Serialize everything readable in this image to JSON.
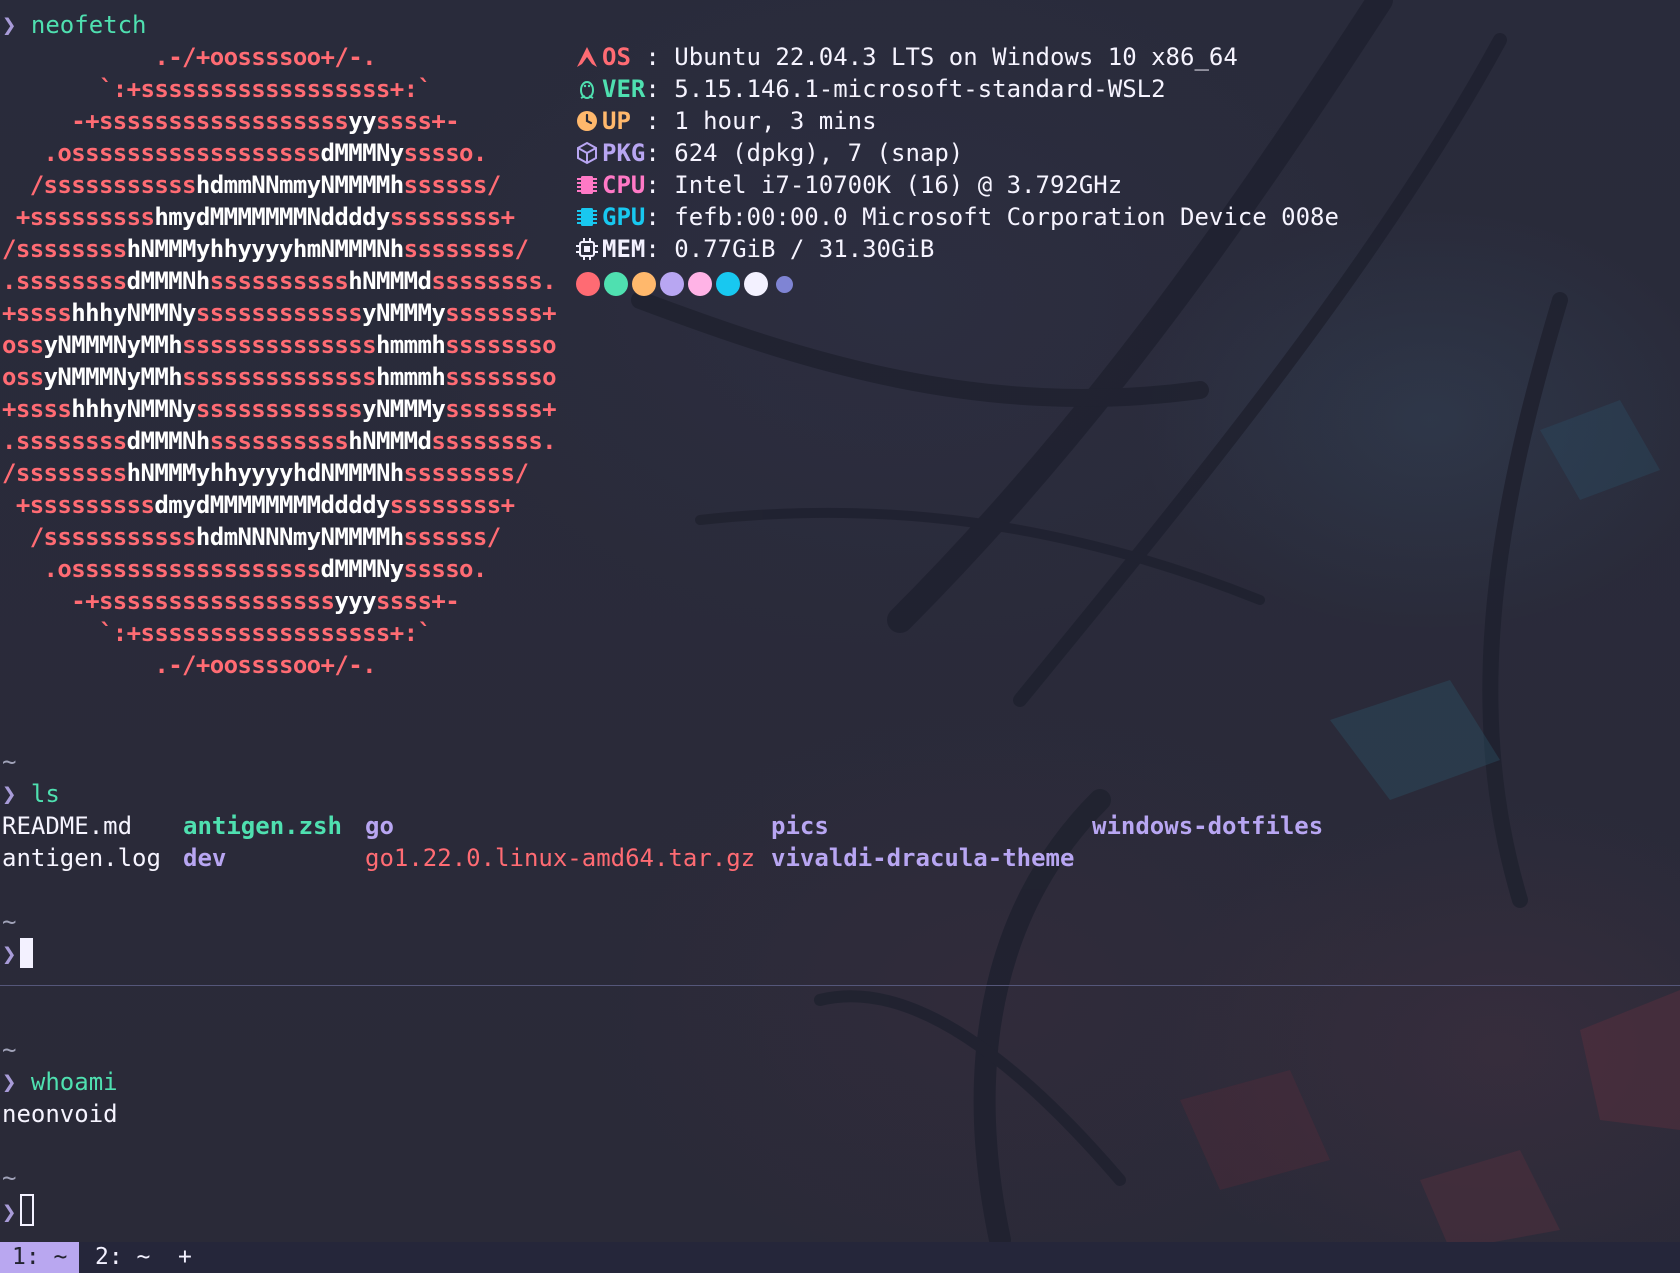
{
  "colors": {
    "background": "#282a38",
    "accent_purple": "#b9a7f0",
    "prompt": "#a89bd8",
    "command": "#4fe0b0",
    "ascii_red": "#ff6b73",
    "key_red": "#ff6b73",
    "key_green": "#4fe0b0",
    "key_orange": "#ffb86c",
    "key_purple": "#b8a6f2",
    "key_pink": "#ff79c6",
    "key_cyan": "#18c8f0",
    "key_white": "#f3f1ff"
  },
  "pane_top": {
    "prompt_symbol": "❯",
    "cmd1": "neofetch",
    "ascii": [
      "           .-/+oossssoo+/-.",
      "       `:+ssssssssssssssssss+:`",
      "     -+ssssssssssssssssssyyssss+-",
      "   .ossssssssssssssssssdMMMNysssso.",
      "  /ssssssssssshdmmNNmmyNMMMMhssssss/",
      " +ssssssssshmydMMMMMMMNddddyssssssss+",
      "/sssssssshNMMMyhhyyyyhmNMMMNhssssssss/",
      ".ssssssssdMMMNhsssssssssshNMMMdssssssss.",
      "+sssshhhyNMMNyssssssssssssyNMMMysssssss+",
      "ossyNMMMNyMMhsssssssssssssshmmmhssssssso",
      "ossyNMMMNyMMhsssssssssssssshmmmhssssssso",
      "+sssshhhyNMMNyssssssssssssyNMMMysssssss+",
      ".ssssssssdMMMNhsssssssssshNMMMdssssssss.",
      "/sssssssshNMMMyhhyyyyhdNMMMNhssssssss/",
      " +sssssssssdmydMMMMMMMMddddyssssssss+",
      "  /ssssssssssshdmNNNNmyNMMMMhssssss/",
      "   .ossssssssssssssssssdMMMNysssso.",
      "     -+sssssssssssssssssyyyssss+-",
      "       `:+ssssssssssssssssss+:`",
      "           .-/+oossssoo+/-."
    ],
    "info": [
      {
        "icon": "arch-icon",
        "key": "OS ",
        "color": "#ff6b73",
        "sep": ":",
        "value": "Ubuntu 22.04.3 LTS on Windows 10 x86_64"
      },
      {
        "icon": "tux-icon",
        "key": "VER",
        "color": "#4fe0b0",
        "sep": ":",
        "value": "5.15.146.1-microsoft-standard-WSL2"
      },
      {
        "icon": "clock-icon",
        "key": "UP ",
        "color": "#ffb86c",
        "sep": ":",
        "value": "1 hour, 3 mins"
      },
      {
        "icon": "package-icon",
        "key": "PKG",
        "color": "#b8a6f2",
        "sep": ":",
        "value": "624 (dpkg), 7 (snap)"
      },
      {
        "icon": "cpu-icon",
        "key": "CPU",
        "color": "#ff79c6",
        "sep": ":",
        "value": "Intel i7-10700K (16) @ 3.792GHz"
      },
      {
        "icon": "gpu-icon",
        "key": "GPU",
        "color": "#18c8f0",
        "sep": ":",
        "value": "fefb:00:00.0 Microsoft Corporation Device 008e"
      },
      {
        "icon": "memory-icon",
        "key": "MEM",
        "color": "#f3f1ff",
        "sep": ":",
        "value": "0.77GiB / 31.30GiB"
      }
    ],
    "swatches": [
      "#ff6b73",
      "#4fe0b0",
      "#ffb86c",
      "#b8a6f2",
      "#ffb3e6",
      "#18c8f0",
      "#f3f1ff",
      "#7f84d4"
    ],
    "tilde": "~",
    "cmd2": "ls",
    "ls_items": [
      {
        "name": "README.md",
        "kind": "plain"
      },
      {
        "name": "antigen.zsh",
        "kind": "green"
      },
      {
        "name": "go",
        "kind": "purple"
      },
      {
        "name": "pics",
        "kind": "purple"
      },
      {
        "name": "windows-dotfiles",
        "kind": "purple"
      },
      {
        "name": "antigen.log",
        "kind": "plain"
      },
      {
        "name": "dev",
        "kind": "purple"
      },
      {
        "name": "go1.22.0.linux-amd64.tar.gz",
        "kind": "red"
      },
      {
        "name": "vivaldi-dracula-theme",
        "kind": "purple"
      }
    ]
  },
  "pane_bottom": {
    "tilde": "~",
    "cmd": "whoami",
    "output": "neonvoid"
  },
  "tabs": [
    {
      "label": "1: ~",
      "active": true
    },
    {
      "label": "2: ~",
      "active": false
    },
    {
      "label": "+",
      "active": false
    }
  ]
}
